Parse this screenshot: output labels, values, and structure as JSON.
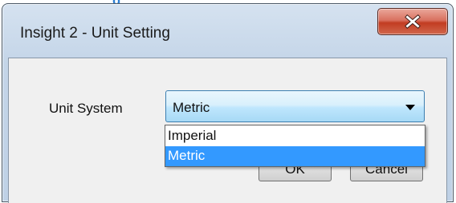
{
  "window": {
    "title": "Insight 2 - Unit Setting"
  },
  "form": {
    "unit_label": "Unit System",
    "unit_value": "Metric",
    "options": [
      "Imperial",
      "Metric"
    ],
    "highlighted_option": "Metric"
  },
  "buttons": {
    "ok_label": "OK",
    "cancel_label": "Cancel"
  },
  "icons": {
    "close": "close-icon",
    "dropdown": "chevron-down-icon"
  },
  "colors": {
    "selection": "#3399ff",
    "close_button": "#c23c22",
    "combo_border": "#3c7fb1"
  }
}
